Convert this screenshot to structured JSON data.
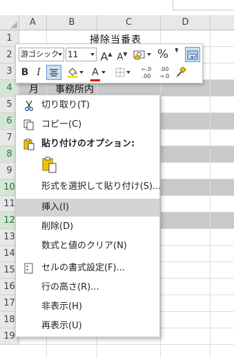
{
  "columns": [
    "A",
    "B",
    "C",
    "D"
  ],
  "rows": [
    "1",
    "2",
    "3",
    "4",
    "5",
    "6",
    "7",
    "8",
    "9",
    "10",
    "11",
    "12",
    "13",
    "14",
    "15",
    "16",
    "17",
    "18",
    "19"
  ],
  "selected_rows": [
    "4",
    "6",
    "8",
    "10",
    "12"
  ],
  "cells": {
    "c1": "掃除当番表",
    "a4": "月",
    "b4": "事務所内"
  },
  "mini_toolbar": {
    "font_name": "游ゴシック",
    "font_size": "11",
    "grow_font": "A",
    "shrink_font": "A",
    "percent": "%",
    "comma": "❜",
    "bold": "B",
    "italic": "I",
    "font_color_letter": "A",
    "font_color_hex": "#e00000",
    "fill_color_hex": "#ffe000",
    "increase_decimal": "←.0 .00",
    "decrease_decimal": ".00 →.0"
  },
  "context_menu": {
    "cut": "切り取り(T)",
    "copy": "コピー(C)",
    "paste_options": "貼り付けのオプション:",
    "paste_special": "形式を選択して貼り付け(S)...",
    "insert": "挿入(I)",
    "delete": "削除(D)",
    "clear": "数式と値のクリア(N)",
    "format_cells": "セルの書式設定(F)...",
    "row_height": "行の高さ(R)...",
    "hide": "非表示(H)",
    "unhide": "再表示(U)"
  }
}
